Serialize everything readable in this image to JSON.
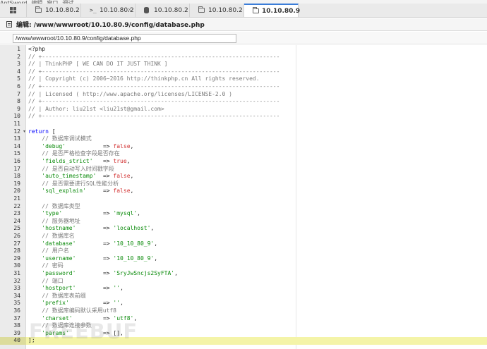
{
  "menubar": {
    "items": [
      "AntSword",
      "编辑",
      "窗口",
      "调试"
    ]
  },
  "tabs": [
    {
      "icon": "folder-icon",
      "label": "10.10.80.2",
      "active": false,
      "closable": false
    },
    {
      "icon": "terminal-icon",
      "label": "10.10.80.2",
      "active": false,
      "closable": true
    },
    {
      "icon": "database-icon",
      "label": "10.10.80.2",
      "active": false,
      "closable": false
    },
    {
      "icon": "folder-icon",
      "label": "10.10.80.2",
      "active": false,
      "closable": false
    },
    {
      "icon": "folder-icon",
      "label": "10.10.80.9",
      "active": true,
      "closable": false
    }
  ],
  "editor": {
    "title": "编辑: /www/wwwroot/10.10.80.9/config/database.php",
    "path": "/www/wwwroot/10.10.80.9/config/database.php",
    "active_line": 40,
    "fold_line": 12
  },
  "colors": {
    "comment": "#7a7a7a",
    "keyword": "#0000ff",
    "string": "#0a8a0a",
    "boolean": "#d23232",
    "plain": "#222222",
    "active_line": "#f4f4a8"
  },
  "code_lines": [
    [
      [
        "plain",
        "<?php"
      ]
    ],
    [
      [
        "comment",
        "// +----------------------------------------------------------------------"
      ]
    ],
    [
      [
        "comment",
        "// | ThinkPHP [ WE CAN DO IT JUST THINK ]"
      ]
    ],
    [
      [
        "comment",
        "// +----------------------------------------------------------------------"
      ]
    ],
    [
      [
        "comment",
        "// | Copyright (c) 2006~2016 http://thinkphp.cn All rights reserved."
      ]
    ],
    [
      [
        "comment",
        "// +----------------------------------------------------------------------"
      ]
    ],
    [
      [
        "comment",
        "// | Licensed ( http://www.apache.org/licenses/LICENSE-2.0 )"
      ]
    ],
    [
      [
        "comment",
        "// +----------------------------------------------------------------------"
      ]
    ],
    [
      [
        "comment",
        "// | Author: liu21st <liu21st@gmail.com>"
      ]
    ],
    [
      [
        "comment",
        "// +----------------------------------------------------------------------"
      ]
    ],
    [],
    [
      [
        "keyword",
        "return"
      ],
      [
        "plain",
        " ["
      ]
    ],
    [
      [
        "comment",
        "    // 数据库调试模式"
      ]
    ],
    [
      [
        "string",
        "    'debug'"
      ],
      [
        "plain",
        "           => "
      ],
      [
        "boolean",
        "false"
      ],
      [
        "plain",
        ","
      ]
    ],
    [
      [
        "comment",
        "    // 是否严格检查字段是否存在"
      ]
    ],
    [
      [
        "string",
        "    'fields_strict'"
      ],
      [
        "plain",
        "   => "
      ],
      [
        "boolean",
        "true"
      ],
      [
        "plain",
        ","
      ]
    ],
    [
      [
        "comment",
        "    // 是否自动写入时间戳字段"
      ]
    ],
    [
      [
        "string",
        "    'auto_timestamp'"
      ],
      [
        "plain",
        "  => "
      ],
      [
        "boolean",
        "false"
      ],
      [
        "plain",
        ","
      ]
    ],
    [
      [
        "comment",
        "    // 是否需要进行SQL性能分析"
      ]
    ],
    [
      [
        "string",
        "    'sql_explain'"
      ],
      [
        "plain",
        "     => "
      ],
      [
        "boolean",
        "false"
      ],
      [
        "plain",
        ","
      ]
    ],
    [],
    [
      [
        "comment",
        "    // 数据库类型"
      ]
    ],
    [
      [
        "string",
        "    'type'"
      ],
      [
        "plain",
        "            => "
      ],
      [
        "string",
        "'mysql'"
      ],
      [
        "plain",
        ","
      ]
    ],
    [
      [
        "comment",
        "    // 服务器地址"
      ]
    ],
    [
      [
        "string",
        "    'hostname'"
      ],
      [
        "plain",
        "        => "
      ],
      [
        "string",
        "'localhost'"
      ],
      [
        "plain",
        ","
      ]
    ],
    [
      [
        "comment",
        "    // 数据库名"
      ]
    ],
    [
      [
        "string",
        "    'database'"
      ],
      [
        "plain",
        "        => "
      ],
      [
        "string",
        "'10_10_80_9'"
      ],
      [
        "plain",
        ","
      ]
    ],
    [
      [
        "comment",
        "    // 用户名"
      ]
    ],
    [
      [
        "string",
        "    'username'"
      ],
      [
        "plain",
        "        => "
      ],
      [
        "string",
        "'10_10_80_9'"
      ],
      [
        "plain",
        ","
      ]
    ],
    [
      [
        "comment",
        "    // 密码"
      ]
    ],
    [
      [
        "string",
        "    'password'"
      ],
      [
        "plain",
        "        => "
      ],
      [
        "string",
        "'SryJwSncjs2SyFTA'"
      ],
      [
        "plain",
        ","
      ]
    ],
    [
      [
        "comment",
        "    // 端口"
      ]
    ],
    [
      [
        "string",
        "    'hostport'"
      ],
      [
        "plain",
        "        => "
      ],
      [
        "string",
        "''"
      ],
      [
        "plain",
        ","
      ]
    ],
    [
      [
        "comment",
        "    // 数据库表前缀"
      ]
    ],
    [
      [
        "string",
        "    'prefix'"
      ],
      [
        "plain",
        "          => "
      ],
      [
        "string",
        "''"
      ],
      [
        "plain",
        ","
      ]
    ],
    [
      [
        "comment",
        "    // 数据库编码默认采用utf8"
      ]
    ],
    [
      [
        "string",
        "    'charset'"
      ],
      [
        "plain",
        "         => "
      ],
      [
        "string",
        "'utf8'"
      ],
      [
        "plain",
        ","
      ]
    ],
    [
      [
        "comment",
        "    // 数据库连接参数"
      ]
    ],
    [
      [
        "string",
        "    'params'"
      ],
      [
        "plain",
        "          => [],"
      ]
    ],
    [
      [
        "plain",
        "];"
      ]
    ]
  ],
  "watermark": "FREEBUF"
}
